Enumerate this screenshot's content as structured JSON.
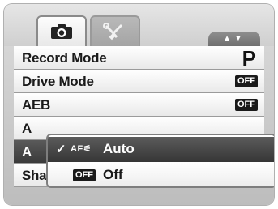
{
  "tabs": [
    {
      "name": "camera",
      "icon": "camera-icon",
      "active": true
    },
    {
      "name": "setup",
      "icon": "wrench-screwdriver-icon",
      "active": false
    }
  ],
  "scroll_hint": "▲▼",
  "menu": {
    "items": [
      {
        "label": "Record Mode",
        "value": "P"
      },
      {
        "label": "Drive Mode",
        "value": "OFF"
      },
      {
        "label": "AEB",
        "value": "OFF"
      },
      {
        "label": "A",
        "value": ""
      },
      {
        "label": "A",
        "value": ""
      },
      {
        "label": "Sharpness",
        "value": ""
      }
    ]
  },
  "popup": {
    "options": [
      {
        "check": "✓",
        "icon_text": "AF⚟",
        "label": "Auto",
        "selected": true
      },
      {
        "badge": "OFF",
        "label": "Off",
        "selected": false
      }
    ]
  }
}
